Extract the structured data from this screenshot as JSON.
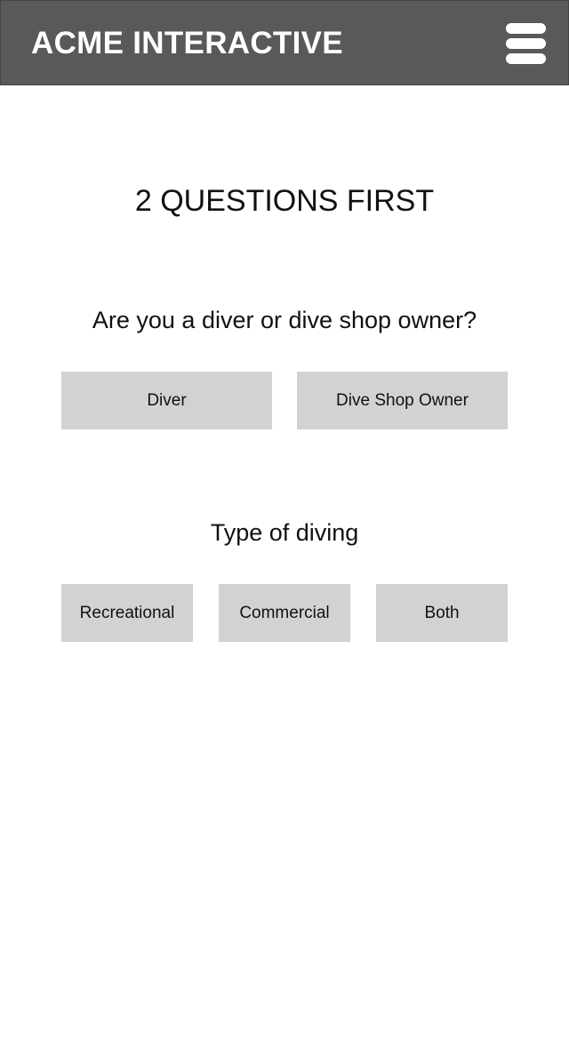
{
  "header": {
    "brand": "ACME INTERACTIVE",
    "menu_icon": "hamburger-menu-icon"
  },
  "main": {
    "title": "2 QUESTIONS FIRST",
    "q1": {
      "text": "Are you a diver or dive shop owner?",
      "options": [
        "Diver",
        "Dive Shop Owner"
      ]
    },
    "q2": {
      "text": "Type of diving",
      "options": [
        "Recreational",
        "Commercial",
        "Both"
      ]
    }
  },
  "colors": {
    "header_bg": "#59595b",
    "button_bg": "#d1d2d4",
    "text": "#111111"
  }
}
